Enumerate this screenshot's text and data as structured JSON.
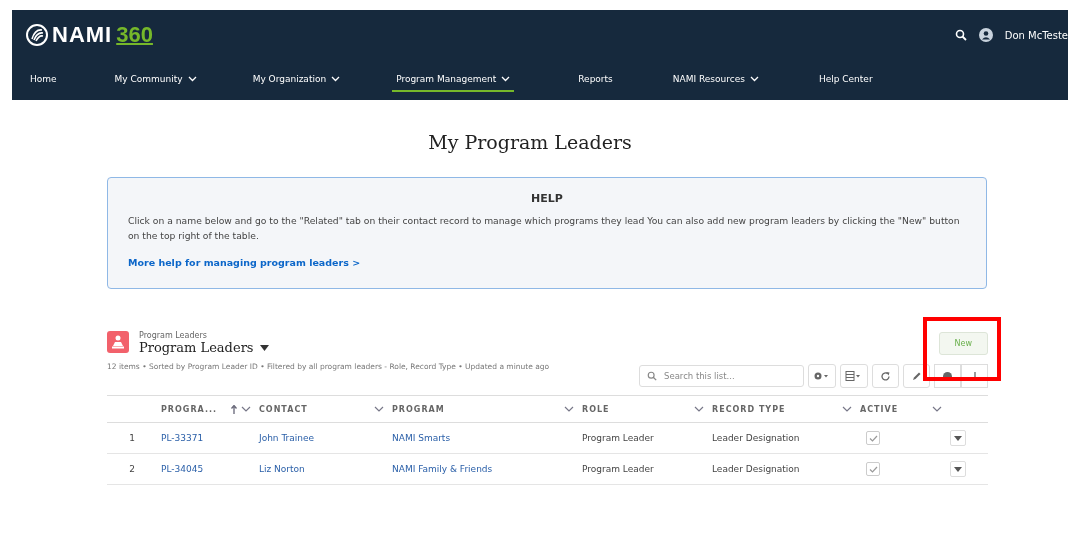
{
  "header": {
    "logo_text": "NAMI",
    "logo_number": "360",
    "user": "Don McTeste"
  },
  "nav": [
    {
      "label": "Home",
      "has_menu": false,
      "selected": false
    },
    {
      "label": "My Community",
      "has_menu": true,
      "selected": false
    },
    {
      "label": "My Organization",
      "has_menu": true,
      "selected": false
    },
    {
      "label": "Program Management",
      "has_menu": true,
      "selected": true
    },
    {
      "label": "Reports",
      "has_menu": false,
      "selected": false
    },
    {
      "label": "NAMI Resources",
      "has_menu": true,
      "selected": false
    },
    {
      "label": "Help Center",
      "has_menu": false,
      "selected": false
    }
  ],
  "page_title": "My Program Leaders",
  "help": {
    "title": "HELP",
    "text": "Click on a name below and go to the \"Related\" tab on their contact record to manage which programs they lead You can also add new program leaders by clicking the \"New\" button on the top right of the table.",
    "link": "More help for managing program leaders >"
  },
  "list": {
    "object": "Program Leaders",
    "view": "Program Leaders",
    "summary": "12 items • Sorted by Program Leader ID • Filtered by all program leaders - Role, Record Type • Updated a minute ago",
    "new_button": "New",
    "search": {
      "placeholder": "Search this list..."
    },
    "columns": [
      {
        "label": "PROGRA...",
        "sorted": true
      },
      {
        "label": "CONTACT",
        "sorted": false
      },
      {
        "label": "PROGRAM",
        "sorted": false
      },
      {
        "label": "ROLE",
        "sorted": false
      },
      {
        "label": "RECORD TYPE",
        "sorted": false
      },
      {
        "label": "ACTIVE",
        "sorted": false
      }
    ],
    "rows": [
      {
        "number": "1",
        "id": "PL-33371",
        "contact": "John Trainee",
        "program": "NAMI Smarts",
        "role": "Program Leader",
        "record_type": "Leader Designation",
        "active": true
      },
      {
        "number": "2",
        "id": "PL-34045",
        "contact": "Liz Norton",
        "program": "NAMI Family & Friends",
        "role": "Program Leader",
        "record_type": "Leader Designation",
        "active": true
      }
    ]
  }
}
